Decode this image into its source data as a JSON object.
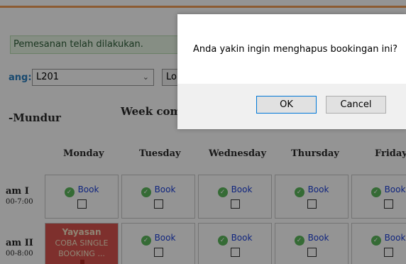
{
  "notice": "Pemesanan telah dilakukan.",
  "room": {
    "label": "ang:",
    "value": "L201",
    "next_label": "Lo"
  },
  "nav": {
    "back": "-Mundur",
    "week": "Week comm"
  },
  "days": [
    "Monday",
    "Tuesday",
    "Wednesday",
    "Thursday",
    "Friday"
  ],
  "slots": [
    {
      "name": "am I",
      "time": "00-7:00"
    },
    {
      "name": "am II",
      "time": "00-8:00"
    }
  ],
  "book_label": "Book",
  "booked": {
    "line1": "Yayasan",
    "line2": "COBA SINGLE",
    "line3": "BOOKING ..."
  },
  "dialog": {
    "message": "Anda yakin ingin menghapus bookingan ini?",
    "ok": "OK",
    "cancel": "Cancel"
  },
  "colors": {
    "top_bar": "#f29d57",
    "booked_cell": "#d9534f",
    "link": "#1a3fd9"
  },
  "icons": {
    "book": "check-circle-icon",
    "select": "chevron-down-icon"
  }
}
